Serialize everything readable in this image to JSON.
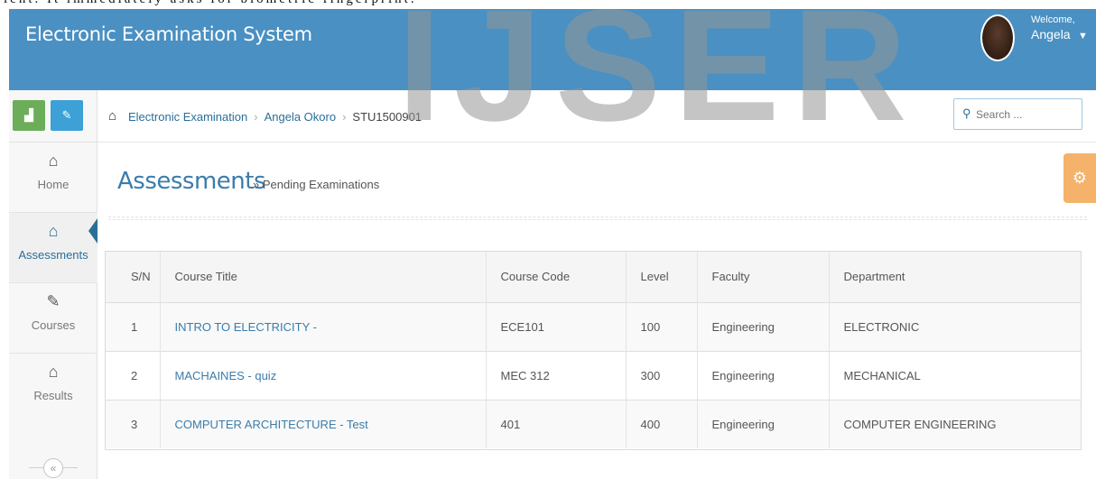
{
  "doc_strip": "ient. It immediately asks for biometric fingerprint.",
  "watermark": "IJSER",
  "header": {
    "app_title": "Electronic Examination System",
    "welcome": "Welcome,",
    "user_name": "Angela",
    "accent_color": "#4a90c2"
  },
  "sidebar": {
    "top_buttons": [
      {
        "name": "stats-icon",
        "glyph": "▟"
      },
      {
        "name": "pencil-icon",
        "glyph": "✎"
      }
    ],
    "items": [
      {
        "label": "Home",
        "icon": "home-icon",
        "glyph": "⌂",
        "active": false
      },
      {
        "label": "Assessments",
        "icon": "home-icon",
        "glyph": "⌂",
        "active": true
      },
      {
        "label": "Courses",
        "icon": "edit-icon",
        "glyph": "✎",
        "active": false
      },
      {
        "label": "Results",
        "icon": "home-icon",
        "glyph": "⌂",
        "active": false
      }
    ],
    "collapse_glyph": "«"
  },
  "breadcrumb": {
    "items": [
      "Electronic Examination",
      "Angela Okoro",
      "STU1500901"
    ],
    "separator": "›"
  },
  "search": {
    "placeholder": "Search ..."
  },
  "page": {
    "title": "Assessments",
    "subtitle": "» Pending Examinations"
  },
  "table": {
    "columns": [
      "S/N",
      "Course Title",
      "Course Code",
      "Level",
      "Faculty",
      "Department"
    ],
    "rows": [
      {
        "sn": "1",
        "title": "INTRO TO ELECTRICITY -",
        "code": "ECE101",
        "level": "100",
        "faculty": "Engineering",
        "department": "ELECTRONIC"
      },
      {
        "sn": "2",
        "title": "MACHAINES - quiz",
        "code": "MEC 312",
        "level": "300",
        "faculty": "Engineering",
        "department": "MECHANICAL"
      },
      {
        "sn": "3",
        "title": "COMPUTER ARCHITECTURE - Test",
        "code": "401",
        "level": "400",
        "faculty": "Engineering",
        "department": "COMPUTER ENGINEERING"
      }
    ]
  }
}
